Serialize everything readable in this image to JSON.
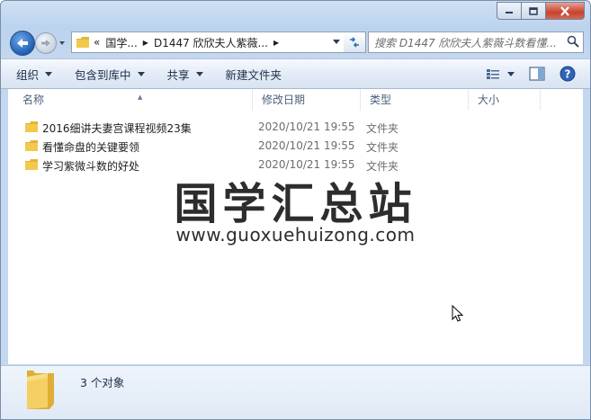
{
  "window": {
    "caption_buttons": [
      "minimize-icon",
      "maximize-icon",
      "close-icon"
    ]
  },
  "address": {
    "prefix": "«",
    "crumbs": [
      "国学...",
      "D1447 欣欣夫人紫薇..."
    ]
  },
  "search": {
    "placeholder": "搜索 D1447 欣欣夫人紫薇斗数看懂..."
  },
  "toolbar": {
    "organize": "组织",
    "include_in_library": "包含到库中",
    "share": "共享",
    "new_folder": "新建文件夹"
  },
  "columns": {
    "name": "名称",
    "date": "修改日期",
    "type": "类型",
    "size": "大小"
  },
  "files": [
    {
      "name": "2016细讲夫妻宫课程视频23集",
      "date": "2020/10/21 19:55",
      "type": "文件夹"
    },
    {
      "name": "看懂命盘的关键要领",
      "date": "2020/10/21 19:55",
      "type": "文件夹"
    },
    {
      "name": "学习紫微斗数的好处",
      "date": "2020/10/21 19:55",
      "type": "文件夹"
    }
  ],
  "watermark": {
    "title": "国学汇总站",
    "url": "www.guoxuehuizong.com"
  },
  "details": {
    "count": "3 个对象"
  },
  "colors": {
    "folder": "#f2c94c",
    "chrome": "#c3d7ef",
    "close": "#c7432e"
  }
}
